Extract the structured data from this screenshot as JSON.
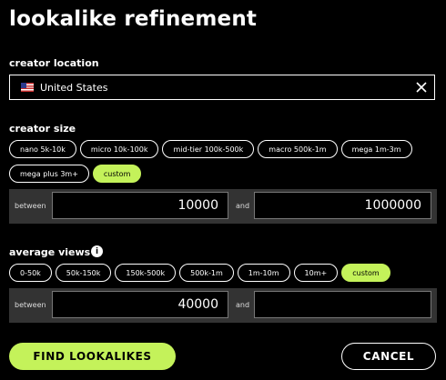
{
  "title": "lookalike refinement",
  "location": {
    "label": "creator location",
    "value": "United States",
    "flag_icon": "us-flag-icon",
    "clear_icon": "close-icon"
  },
  "size": {
    "label": "creator size",
    "chips": [
      {
        "label": "nano 5k-10k",
        "selected": false
      },
      {
        "label": "micro 10k-100k",
        "selected": false
      },
      {
        "label": "mid-tier 100k-500k",
        "selected": false
      },
      {
        "label": "macro 500k-1m",
        "selected": false
      },
      {
        "label": "mega 1m-3m",
        "selected": false
      },
      {
        "label": "mega plus 3m+",
        "selected": false
      },
      {
        "label": "custom",
        "selected": true
      }
    ],
    "between_label": "between",
    "and_label": "and",
    "min_value": "10000",
    "max_value": "1000000"
  },
  "views": {
    "label": "average views",
    "info_icon": "info-icon",
    "chips": [
      {
        "label": "0-50k",
        "selected": false
      },
      {
        "label": "50k-150k",
        "selected": false
      },
      {
        "label": "150k-500k",
        "selected": false
      },
      {
        "label": "500k-1m",
        "selected": false
      },
      {
        "label": "1m-10m",
        "selected": false
      },
      {
        "label": "10m+",
        "selected": false
      },
      {
        "label": "custom",
        "selected": true
      }
    ],
    "between_label": "between",
    "and_label": "and",
    "min_value": "40000",
    "max_value": ""
  },
  "actions": {
    "find_label": "FIND LOOKALIKES",
    "cancel_label": "CANCEL"
  },
  "colors": {
    "accent": "#c4f25a",
    "background": "#000000",
    "panel": "#333333"
  }
}
